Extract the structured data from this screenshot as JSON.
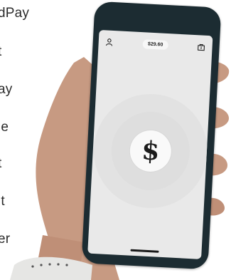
{
  "side_list": {
    "items": [
      {
        "label": "dPay"
      },
      {
        "label": "t"
      },
      {
        "label": "ay"
      },
      {
        "label": "le"
      },
      {
        "label": "t"
      },
      {
        "label": "it"
      },
      {
        "label": "er"
      }
    ]
  },
  "phone": {
    "status_bar": {
      "profile_icon": "person-icon",
      "balance": "$29.60",
      "activity_icon": "shop-icon"
    },
    "main": {
      "center_icon": "dollar-sign-icon",
      "center_glyph": "$"
    }
  },
  "colors": {
    "phone_frame": "#1c2c32",
    "screen_bg": "#e9e9e9",
    "skin": "#c79a82"
  }
}
